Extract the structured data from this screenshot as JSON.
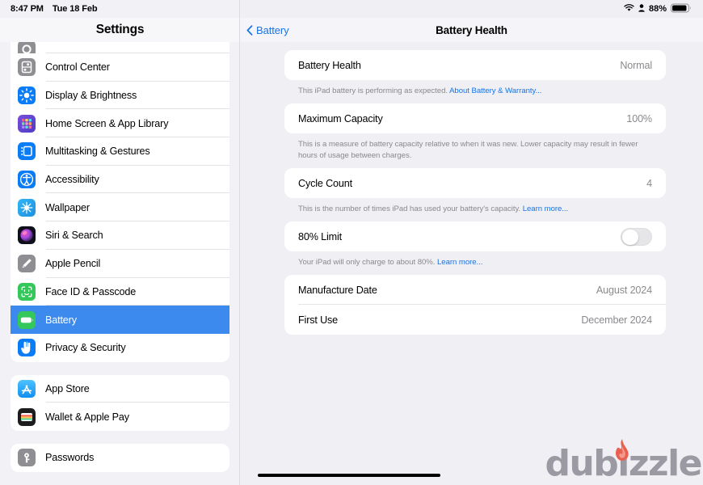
{
  "status_bar": {
    "time": "8:47 PM",
    "date": "Tue 18 Feb",
    "battery_percent": "88%",
    "wifi_icon": "wifi-icon",
    "person_icon": "person-icon",
    "battery_icon": "battery-icon"
  },
  "sidebar": {
    "title": "Settings",
    "groups": [
      {
        "clipped_top": true,
        "items": [
          {
            "label": "",
            "icon": "general-icon",
            "partial": true,
            "selected": false
          },
          {
            "label": "Control Center",
            "icon": "control-center-icon",
            "selected": false
          },
          {
            "label": "Display & Brightness",
            "icon": "display-brightness-icon",
            "selected": false
          },
          {
            "label": "Home Screen & App Library",
            "icon": "home-screen-icon",
            "selected": false
          },
          {
            "label": "Multitasking & Gestures",
            "icon": "multitasking-icon",
            "selected": false
          },
          {
            "label": "Accessibility",
            "icon": "accessibility-icon",
            "selected": false
          },
          {
            "label": "Wallpaper",
            "icon": "wallpaper-icon",
            "selected": false
          },
          {
            "label": "Siri & Search",
            "icon": "siri-icon",
            "selected": false
          },
          {
            "label": "Apple Pencil",
            "icon": "apple-pencil-icon",
            "selected": false
          },
          {
            "label": "Face ID & Passcode",
            "icon": "face-id-icon",
            "selected": false
          },
          {
            "label": "Battery",
            "icon": "battery-settings-icon",
            "selected": true
          },
          {
            "label": "Privacy & Security",
            "icon": "privacy-security-icon",
            "selected": false
          }
        ]
      },
      {
        "clipped_top": false,
        "items": [
          {
            "label": "App Store",
            "icon": "app-store-icon",
            "selected": false
          },
          {
            "label": "Wallet & Apple Pay",
            "icon": "wallet-icon",
            "selected": false
          }
        ]
      },
      {
        "clipped_top": false,
        "items": [
          {
            "label": "Passwords",
            "icon": "passwords-icon",
            "selected": false
          }
        ]
      }
    ]
  },
  "detail": {
    "back_label": "Battery",
    "title": "Battery Health",
    "sections": [
      {
        "rows": [
          {
            "label": "Battery Health",
            "value": "Normal",
            "type": "value"
          }
        ],
        "footnote_text": "This iPad battery is performing as expected. ",
        "footnote_link": "About Battery & Warranty..."
      },
      {
        "rows": [
          {
            "label": "Maximum Capacity",
            "value": "100%",
            "type": "value"
          }
        ],
        "footnote_text": "This is a measure of battery capacity relative to when it was new. Lower capacity may result in fewer hours of usage between charges.",
        "footnote_link": ""
      },
      {
        "rows": [
          {
            "label": "Cycle Count",
            "value": "4",
            "type": "value"
          }
        ],
        "footnote_text": "This is the number of times iPad has used your battery's capacity. ",
        "footnote_link": "Learn more..."
      },
      {
        "rows": [
          {
            "label": "80% Limit",
            "value": "",
            "type": "toggle",
            "toggle_on": false
          }
        ],
        "footnote_text": "Your iPad will only charge to about 80%. ",
        "footnote_link": "Learn more..."
      },
      {
        "rows": [
          {
            "label": "Manufacture Date",
            "value": "August 2024",
            "type": "value"
          },
          {
            "label": "First Use",
            "value": "December 2024",
            "type": "value"
          }
        ],
        "footnote_text": "",
        "footnote_link": ""
      }
    ]
  },
  "watermark": {
    "text": "dubizzle",
    "flame_icon": "flame-icon"
  },
  "colors": {
    "accent_blue": "#1574e8",
    "selection_blue": "#3c8aed",
    "bg_gray": "#f0eff4",
    "sidebar_bg": "#f2f1f6",
    "secondary_text": "#8a8a8e",
    "flame_red": "#e8604f"
  }
}
